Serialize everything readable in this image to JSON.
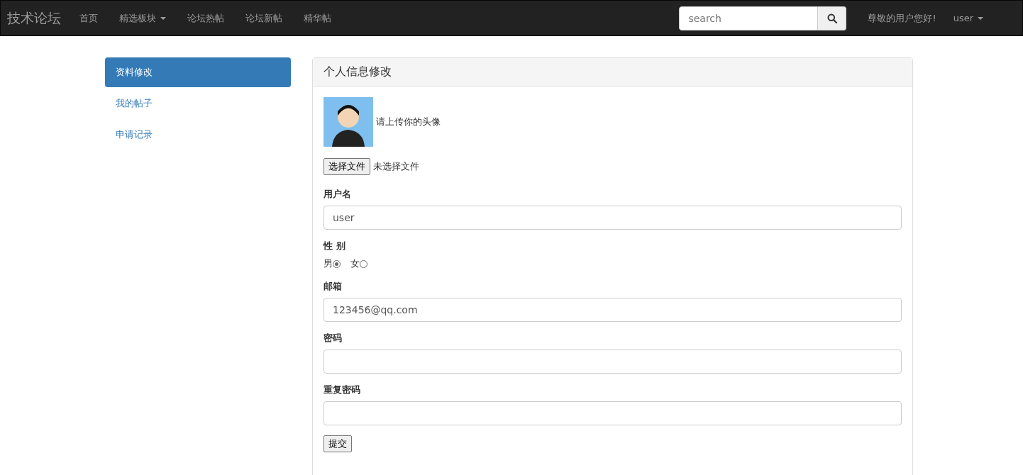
{
  "navbar": {
    "brand": "技术论坛",
    "items": [
      {
        "label": "首页",
        "dropdown": false
      },
      {
        "label": "精选板块",
        "dropdown": true
      },
      {
        "label": "论坛热帖",
        "dropdown": false
      },
      {
        "label": "论坛新帖",
        "dropdown": false
      },
      {
        "label": "精华帖",
        "dropdown": false
      }
    ],
    "search": {
      "placeholder": "search"
    },
    "greeting": "尊敬的用户您好!",
    "user": {
      "label": "user",
      "dropdown": true
    }
  },
  "sidebar": {
    "items": [
      {
        "label": "资料修改",
        "selected": true
      },
      {
        "label": "我的帖子",
        "selected": false
      },
      {
        "label": "申请记录",
        "selected": false
      }
    ]
  },
  "panel": {
    "title": "个人信息修改",
    "avatar_hint": "请上传你的头像",
    "file_button": "选择文件",
    "file_status": "未选择文件",
    "fields": [
      {
        "kind": "text",
        "label": "用户名",
        "value": "user"
      },
      {
        "kind": "radio",
        "label": "性 别",
        "options": [
          {
            "label": "男",
            "selected": true
          },
          {
            "label": "女",
            "selected": false
          }
        ]
      },
      {
        "kind": "text",
        "label": "邮箱",
        "value": "123456@qq.com"
      },
      {
        "kind": "password",
        "label": "密码"
      },
      {
        "kind": "password",
        "label": "重复密码"
      }
    ],
    "submit": "提交"
  }
}
